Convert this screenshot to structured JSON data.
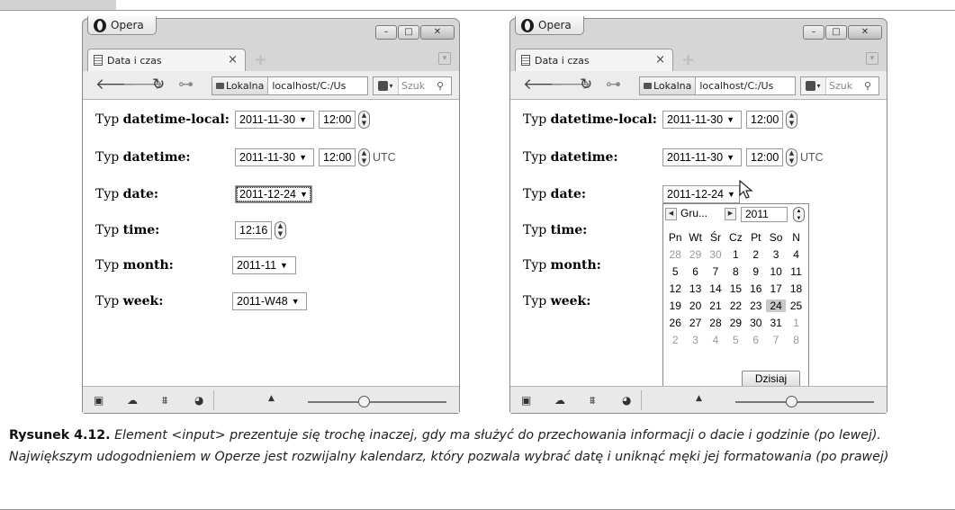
{
  "browser_app_name": "Opera",
  "window_controls": {
    "minimize": "–",
    "maximize": "□",
    "close": "✕"
  },
  "tab_title": "Data i czas",
  "tab_close": "×",
  "new_tab": "+",
  "address": {
    "badge": "Lokalna",
    "url": "localhost/C:/Us"
  },
  "search_placeholder": "Szuk",
  "nav_icons": [
    "back-icon",
    "forward-icon",
    "reload-icon",
    "key-icon"
  ],
  "form": {
    "rows": [
      {
        "prefix": "Typ ",
        "type": "datetime-local:"
      },
      {
        "prefix": "Typ ",
        "type": "datetime:"
      },
      {
        "prefix": "Typ ",
        "type": "date:"
      },
      {
        "prefix": "Typ ",
        "type": "time:"
      },
      {
        "prefix": "Typ ",
        "type": "month:"
      },
      {
        "prefix": "Typ ",
        "type": "week:"
      }
    ],
    "left": {
      "datetime_local_date": "2011-11-30",
      "datetime_local_time": "12:00",
      "datetime_date": "2011-11-30",
      "datetime_time": "12:00",
      "utc": "UTC",
      "date": "2011-12-24",
      "time": "12:16",
      "month": "2011-11",
      "week": "2011-W48"
    },
    "right": {
      "datetime_local_date": "2011-11-30",
      "datetime_local_time": "12:00",
      "datetime_date": "2011-11-30",
      "datetime_time": "12:00",
      "utc": "UTC",
      "date": "2011-12-24"
    }
  },
  "calendar": {
    "month": "Gru...",
    "year": "2011",
    "weekdays": [
      "Pn",
      "Wt",
      "Śr",
      "Cz",
      "Pt",
      "So",
      "N"
    ],
    "weeks": [
      [
        "28",
        "29",
        "30",
        "1",
        "2",
        "3",
        "4"
      ],
      [
        "5",
        "6",
        "7",
        "8",
        "9",
        "10",
        "11"
      ],
      [
        "12",
        "13",
        "14",
        "15",
        "16",
        "17",
        "18"
      ],
      [
        "19",
        "20",
        "21",
        "22",
        "23",
        "24",
        "25"
      ],
      [
        "26",
        "27",
        "28",
        "29",
        "30",
        "31",
        "1"
      ],
      [
        "2",
        "3",
        "4",
        "5",
        "6",
        "7",
        "8"
      ]
    ],
    "muted": [
      [
        0,
        0
      ],
      [
        0,
        1
      ],
      [
        0,
        2
      ],
      [
        4,
        6
      ],
      [
        5,
        0
      ],
      [
        5,
        1
      ],
      [
        5,
        2
      ],
      [
        5,
        3
      ],
      [
        5,
        4
      ],
      [
        5,
        5
      ],
      [
        5,
        6
      ]
    ],
    "selected": [
      3,
      5
    ],
    "today_button": "Dzisiaj"
  },
  "caption": {
    "label": "Rysunek 4.12.",
    "text": "Element <input> prezentuje się trochę inaczej, gdy ma służyć do przechowania informacji o dacie i godzinie (po lewej). Największym udogodnieniem w Operze jest rozwijalny kalendarz, który pozwala wybrać datę i uniknąć męki jej formatowania (po prawej)"
  }
}
